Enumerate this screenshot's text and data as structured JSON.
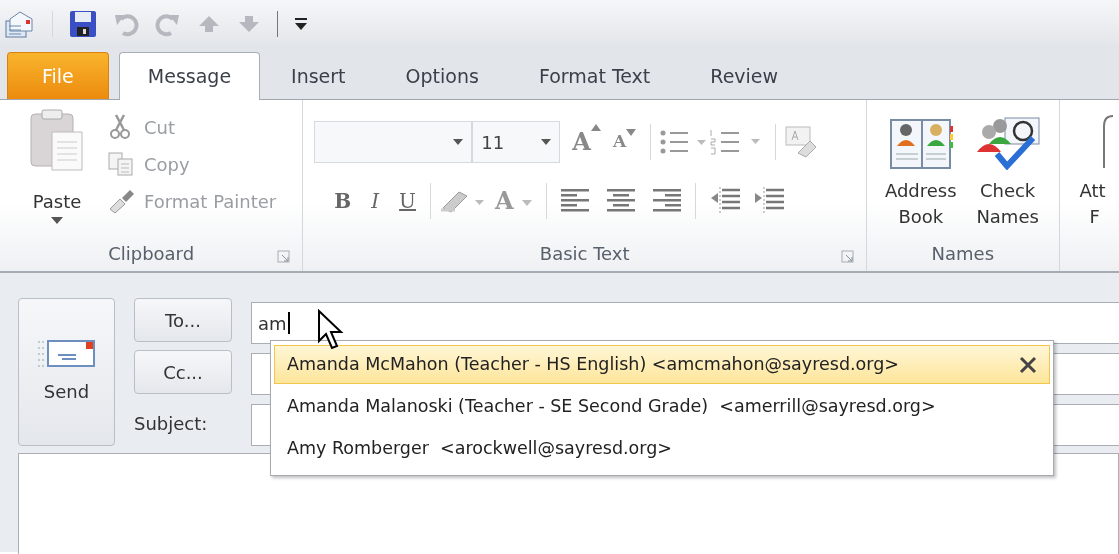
{
  "tabs": [
    {
      "label": "File",
      "kind": "file",
      "selected": false
    },
    {
      "label": "Message",
      "kind": "tab",
      "selected": true
    },
    {
      "label": "Insert",
      "kind": "tab",
      "selected": false
    },
    {
      "label": "Options",
      "kind": "tab",
      "selected": false
    },
    {
      "label": "Format Text",
      "kind": "tab",
      "selected": false
    },
    {
      "label": "Review",
      "kind": "tab",
      "selected": false
    }
  ],
  "clipboard": {
    "title": "Clipboard",
    "paste": "Paste",
    "items": [
      {
        "label": "Cut",
        "kind": "cut",
        "disabled": true
      },
      {
        "label": "Copy",
        "kind": "copy",
        "disabled": true
      },
      {
        "label": "Format Painter",
        "kind": "painter",
        "disabled": true
      }
    ]
  },
  "basic_text": {
    "title": "Basic Text",
    "font_size": "11",
    "grow_font": "A",
    "shrink_font": "A",
    "bold": "B",
    "italic": "I",
    "underline": "U",
    "font_color": "A"
  },
  "names": {
    "title": "Names",
    "buttons": [
      {
        "label": "Address Book",
        "kind": "address_book"
      },
      {
        "label": "Check Names",
        "kind": "check_names"
      }
    ]
  },
  "attach": {
    "line_1": "Att",
    "line_2": "F"
  },
  "compose": {
    "send": "Send",
    "to_button": "To...",
    "cc_button": "Cc...",
    "subject_label": "Subject:",
    "to_value": "am"
  },
  "suggestions": [
    {
      "text": "Amanda McMahon (Teacher - HS English) <amcmahon@sayresd.org>",
      "selected": true
    },
    {
      "text": "Amanda Malanoski (Teacher - SE Second Grade)  <amerrill@sayresd.org>",
      "selected": false
    },
    {
      "text": "Amy Romberger  <arockwell@sayresd.org>",
      "selected": false
    }
  ]
}
